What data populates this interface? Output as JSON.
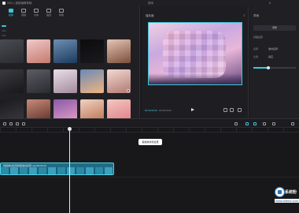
{
  "titlebar": {
    "project": "0511 | 视频编辑草稿",
    "window_title": "剪映",
    "share_label": "⇪"
  },
  "tabs": [
    {
      "label": "媒体"
    },
    {
      "label": "音频"
    },
    {
      "label": "文本"
    },
    {
      "label": "贴纸"
    },
    {
      "label": "特效"
    }
  ],
  "media": {
    "items": [
      {
        "caption": "",
        "color1": "#4a4a52",
        "color2": "#2a2a30"
      },
      {
        "caption": "",
        "color1": "#f0c9c9",
        "color2": "#c47a6e"
      },
      {
        "caption": "",
        "color1": "#6d8fb2",
        "color2": "#1c3a5e"
      },
      {
        "caption": "",
        "color1": "#0c0c0e",
        "color2": "#1a1a1e"
      },
      {
        "caption": "",
        "color1": "#e6c6b6",
        "color2": "#7a4e3a"
      },
      {
        "caption": "素材",
        "color1": "#3a3a40",
        "color2": "#18181b"
      },
      {
        "caption": "素材",
        "color1": "#5c5c66",
        "color2": "#2a2a30"
      },
      {
        "caption": "素材",
        "color1": "#e9dfe8",
        "color2": "#a38b9c"
      },
      {
        "caption": "素材",
        "color1": "#6a8ab8",
        "color2": "#f2b480"
      },
      {
        "caption": "素材",
        "color1": "#f3d9d3",
        "color2": "#b07a70"
      },
      {
        "caption": "素材",
        "color1": "#1a1a1e",
        "color2": "#3a3a40"
      },
      {
        "caption": "素材",
        "color1": "#c98a7a",
        "color2": "#5a2e24"
      },
      {
        "caption": "素材",
        "color1": "#8a5aa8",
        "color2": "#e8a0c8"
      },
      {
        "caption": "素材",
        "color1": "#f0d2c4",
        "color2": "#b8704c"
      },
      {
        "caption": "素材",
        "color1": "#f2c8c0",
        "color2": "#e07a82"
      }
    ]
  },
  "preview": {
    "title": "播放器",
    "menu_label": "≡",
    "time_current": "00:00:00:00",
    "time_total": "00:00:00:00"
  },
  "right_panel": {
    "title": "草稿",
    "button_label": "调整",
    "section_label": "基础设置",
    "rows": [
      {
        "label": "名称",
        "value": "素材名称"
      },
      {
        "label": "比例",
        "value": "适应"
      }
    ],
    "slider_value": 0.35
  },
  "timeline": {
    "hint": "拖拽素材到这里",
    "clip_name": "视频素材名称视频素材名称.mp4",
    "clip_duration": "00:00:15",
    "accent_color": "#3ec7d8"
  },
  "watermark": {
    "title": "系统粉",
    "url": "www.xtfens.com"
  }
}
